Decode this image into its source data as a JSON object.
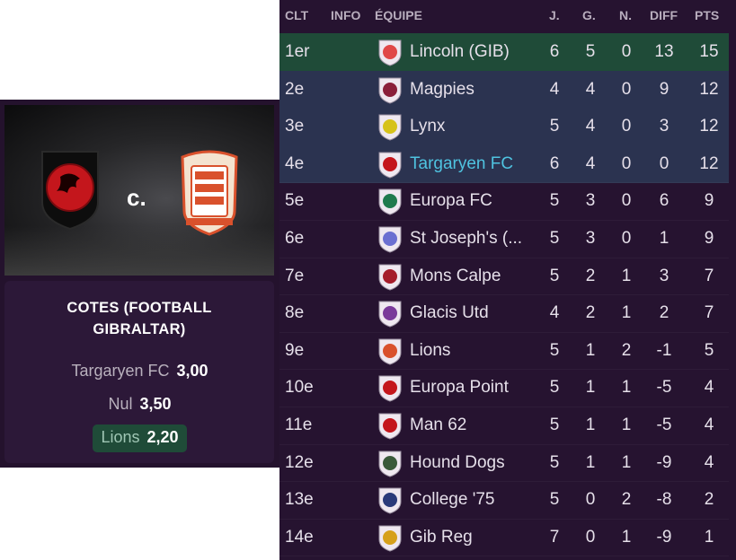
{
  "match": {
    "home_team": "Targaryen FC",
    "away_team": "Lions",
    "versus": "c.",
    "home_crest": "dragon-crest-icon",
    "away_crest": "lions-crest-icon"
  },
  "odds": {
    "title_line1": "COTES (FOOTBALL",
    "title_line2": "GIBRALTAR)",
    "home_label": "Targaryen FC",
    "home_value": "3,00",
    "draw_label": "Nul",
    "draw_value": "3,50",
    "away_label": "Lions",
    "away_value": "2,20"
  },
  "table": {
    "headers": {
      "pos": "CLT",
      "info": "INFO",
      "team": "ÉQUIPE",
      "played": "J.",
      "won": "G.",
      "drawn": "N.",
      "diff": "DIFF",
      "pts": "PTS"
    },
    "rows": [
      {
        "pos": "1er",
        "team": "Lincoln (GIB)",
        "j": "6",
        "g": "5",
        "n": "0",
        "diff": "13",
        "pts": "15"
      },
      {
        "pos": "2e",
        "team": "Magpies",
        "j": "4",
        "g": "4",
        "n": "0",
        "diff": "9",
        "pts": "12"
      },
      {
        "pos": "3e",
        "team": "Lynx",
        "j": "5",
        "g": "4",
        "n": "0",
        "diff": "3",
        "pts": "12"
      },
      {
        "pos": "4e",
        "team": "Targaryen FC",
        "j": "6",
        "g": "4",
        "n": "0",
        "diff": "0",
        "pts": "12"
      },
      {
        "pos": "5e",
        "team": "Europa FC",
        "j": "5",
        "g": "3",
        "n": "0",
        "diff": "6",
        "pts": "9"
      },
      {
        "pos": "6e",
        "team": "St Joseph's (...",
        "j": "5",
        "g": "3",
        "n": "0",
        "diff": "1",
        "pts": "9"
      },
      {
        "pos": "7e",
        "team": "Mons Calpe",
        "j": "5",
        "g": "2",
        "n": "1",
        "diff": "3",
        "pts": "7"
      },
      {
        "pos": "8e",
        "team": "Glacis Utd",
        "j": "4",
        "g": "2",
        "n": "1",
        "diff": "2",
        "pts": "7"
      },
      {
        "pos": "9e",
        "team": "Lions",
        "j": "5",
        "g": "1",
        "n": "2",
        "diff": "-1",
        "pts": "5"
      },
      {
        "pos": "10e",
        "team": "Europa Point",
        "j": "5",
        "g": "1",
        "n": "1",
        "diff": "-5",
        "pts": "4"
      },
      {
        "pos": "11e",
        "team": "Man 62",
        "j": "5",
        "g": "1",
        "n": "1",
        "diff": "-5",
        "pts": "4"
      },
      {
        "pos": "12e",
        "team": "Hound Dogs",
        "j": "5",
        "g": "1",
        "n": "1",
        "diff": "-9",
        "pts": "4"
      },
      {
        "pos": "13e",
        "team": "College '75",
        "j": "5",
        "g": "0",
        "n": "2",
        "diff": "-8",
        "pts": "2"
      },
      {
        "pos": "14e",
        "team": "Gib Reg",
        "j": "7",
        "g": "0",
        "n": "1",
        "diff": "-9",
        "pts": "1"
      }
    ]
  },
  "colors": {
    "leader_row": "#1f4b38",
    "promo_rows": "#2b3350",
    "own_team_text": "#4fc3e0",
    "panel_bg": "#261330"
  }
}
